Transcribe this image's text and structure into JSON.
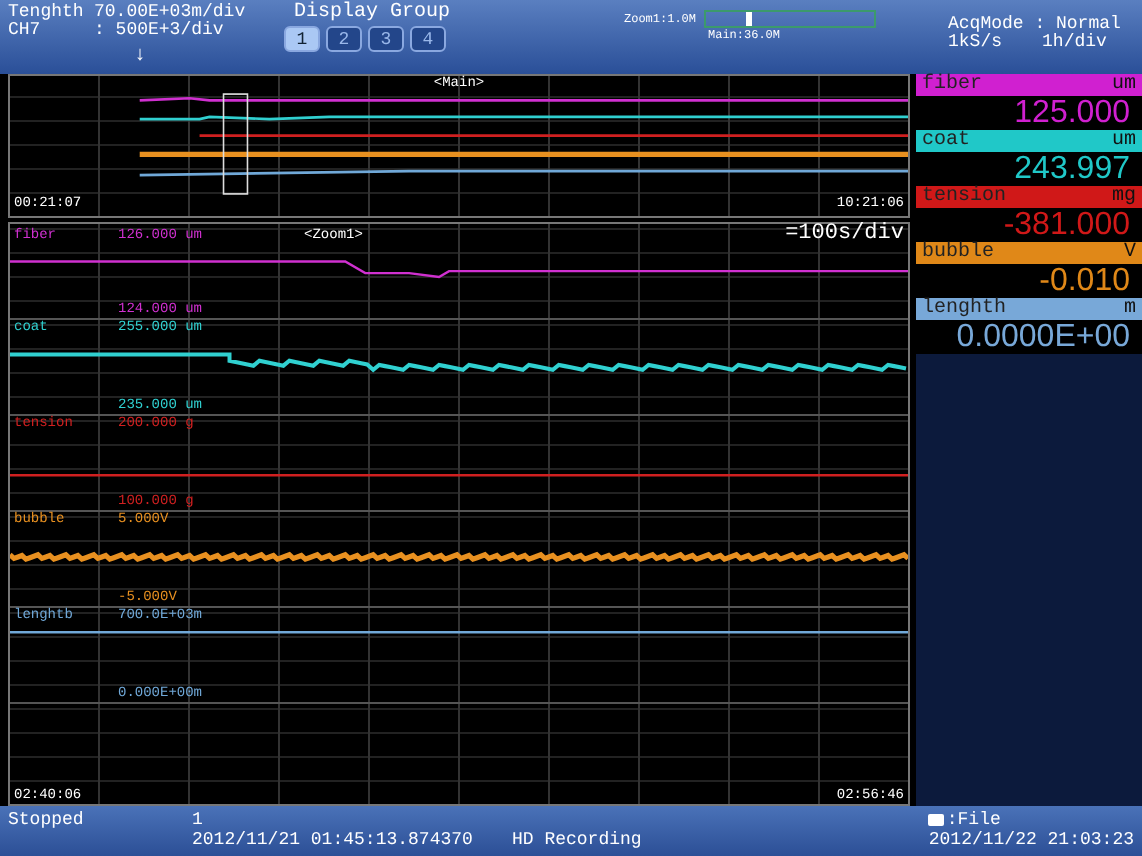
{
  "header": {
    "fields": [
      {
        "label": "Tenghth",
        "value": "70.00E+03m/div"
      },
      {
        "label": "CH7",
        "value": ": 500E+3/div"
      }
    ],
    "trigger_mark": "↓",
    "display_group": {
      "title": "Display Group",
      "buttons": [
        {
          "label": "1",
          "selected": true
        },
        {
          "label": "2",
          "selected": false
        },
        {
          "label": "3",
          "selected": false
        },
        {
          "label": "4",
          "selected": false
        }
      ]
    },
    "zoom_bar": {
      "zoom_label": "Zoom1:1.0M",
      "main_label": "Main:36.0M",
      "level": 0.24
    },
    "acquisition": {
      "mode": "AcqMode : Normal",
      "rate": "1kS/s",
      "timebase": "1h/div"
    }
  },
  "main_view": {
    "title": "<Main>",
    "start_time": "00:21:07",
    "end_time": "10:21:06"
  },
  "zoom_view": {
    "title": "<Zoom1>",
    "timebase": "=100s/div",
    "start_time": "02:40:06",
    "end_time": "02:56:46",
    "channels": [
      {
        "name": "fiber",
        "color": "#d030d0",
        "kind": "step",
        "top": "126.000 um",
        "bottom": "124.000 um"
      },
      {
        "name": "coat",
        "color": "#30d0d0",
        "kind": "noisy-step",
        "top": "255.000 um",
        "bottom": "235.000 um"
      },
      {
        "name": "tension",
        "color": "#d02020",
        "kind": "flat",
        "top": "200.000 g",
        "bottom": "100.000 g"
      },
      {
        "name": "bubble",
        "color": "#e89020",
        "kind": "noise",
        "top": "5.000V",
        "bottom": "-5.000V"
      },
      {
        "name": "lenghtb",
        "color": "#70a8d8",
        "kind": "line",
        "top": "700.0E+03m",
        "bottom": "0.000E+00m"
      }
    ]
  },
  "readouts": [
    {
      "name": "fiber",
      "unit": "um",
      "value": "125.000",
      "color": "#d020d0"
    },
    {
      "name": "coat",
      "unit": "um",
      "value": "243.997",
      "color": "#20c8c8"
    },
    {
      "name": "tension",
      "unit": "mg",
      "value": "-381.000",
      "color": "#d01818"
    },
    {
      "name": "bubble",
      "unit": "V",
      "value": "-0.010",
      "color": "#e08818"
    },
    {
      "name": "lenghth",
      "unit": "m",
      "value": "0.0000E+00",
      "color": "#78a8d8"
    }
  ],
  "status_bar": {
    "state": "Stopped",
    "count": "1",
    "start_time": "2012/11/21 01:45:13.874370",
    "mode": "HD Recording",
    "save_target": ":File",
    "clock": "2012/11/22 21:03:23"
  }
}
